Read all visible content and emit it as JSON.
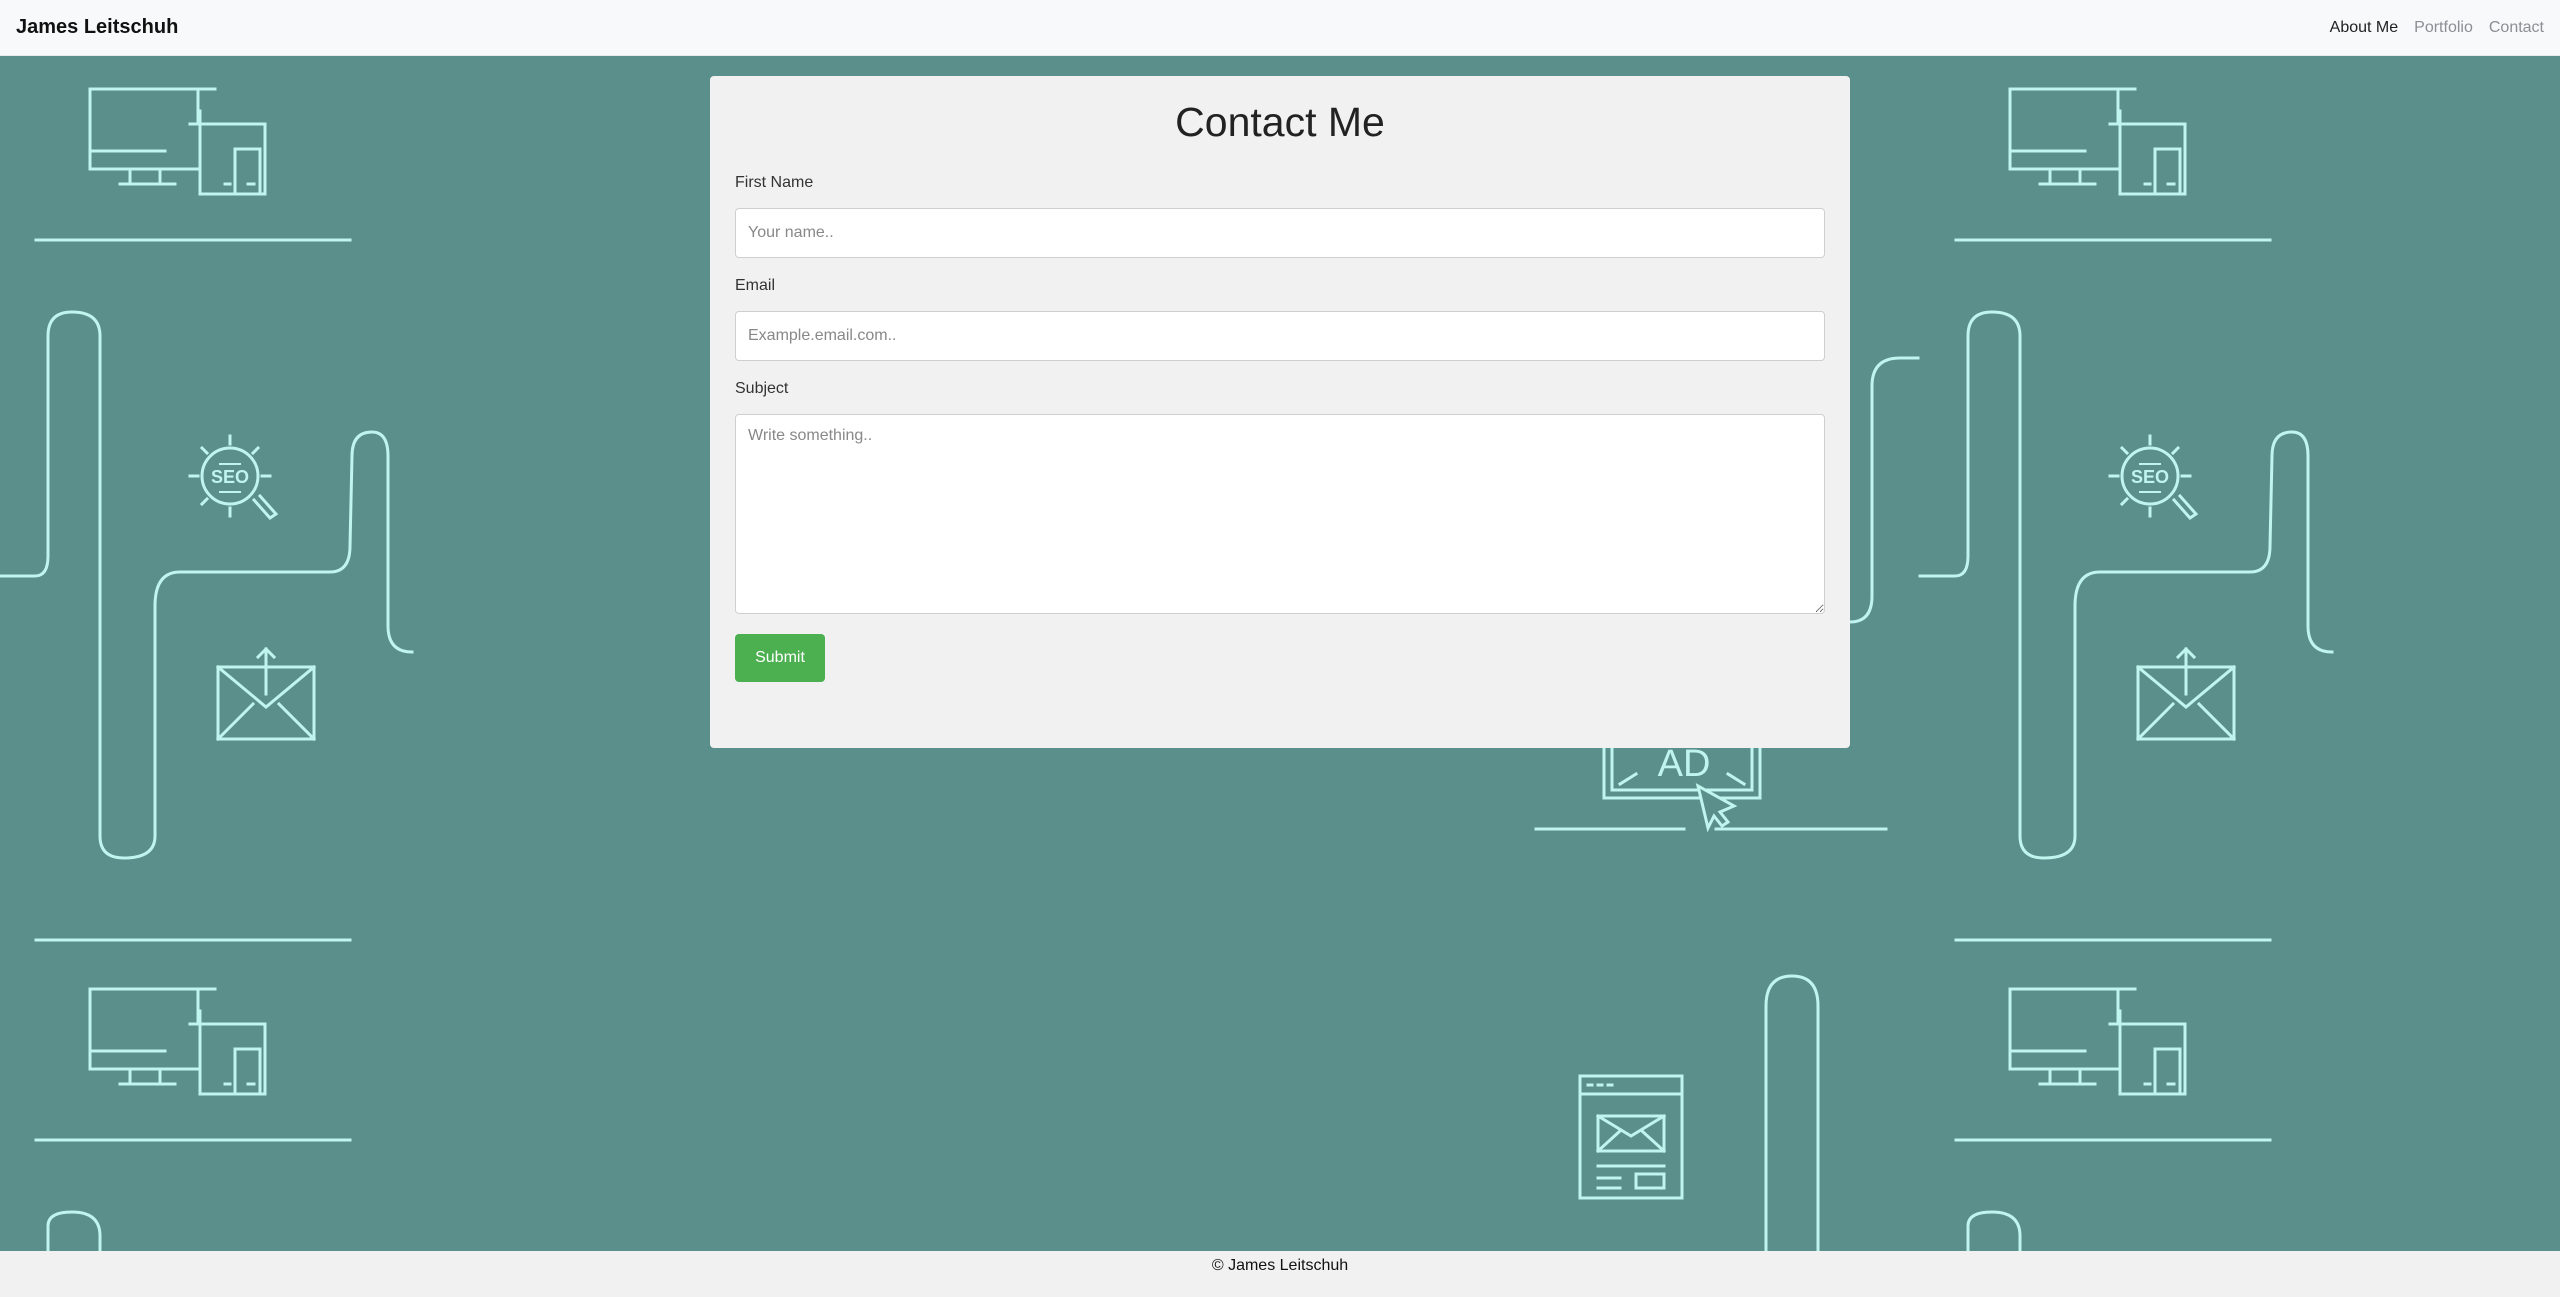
{
  "navbar": {
    "brand": "James Leitschuh",
    "links": [
      "About Me",
      "Portfolio",
      "Contact"
    ]
  },
  "form": {
    "title": "Contact Me",
    "first_name_label": "First Name",
    "first_name_placeholder": "Your name..",
    "email_label": "Email",
    "email_placeholder": "Example.email.com..",
    "subject_label": "Subject",
    "subject_placeholder": "Write something..",
    "submit_label": "Submit"
  },
  "footer": {
    "text": "© James Leitschuh"
  },
  "colors": {
    "background": "#5a8f8c",
    "line_art": "#bff5ee",
    "submit": "#4caf50"
  }
}
